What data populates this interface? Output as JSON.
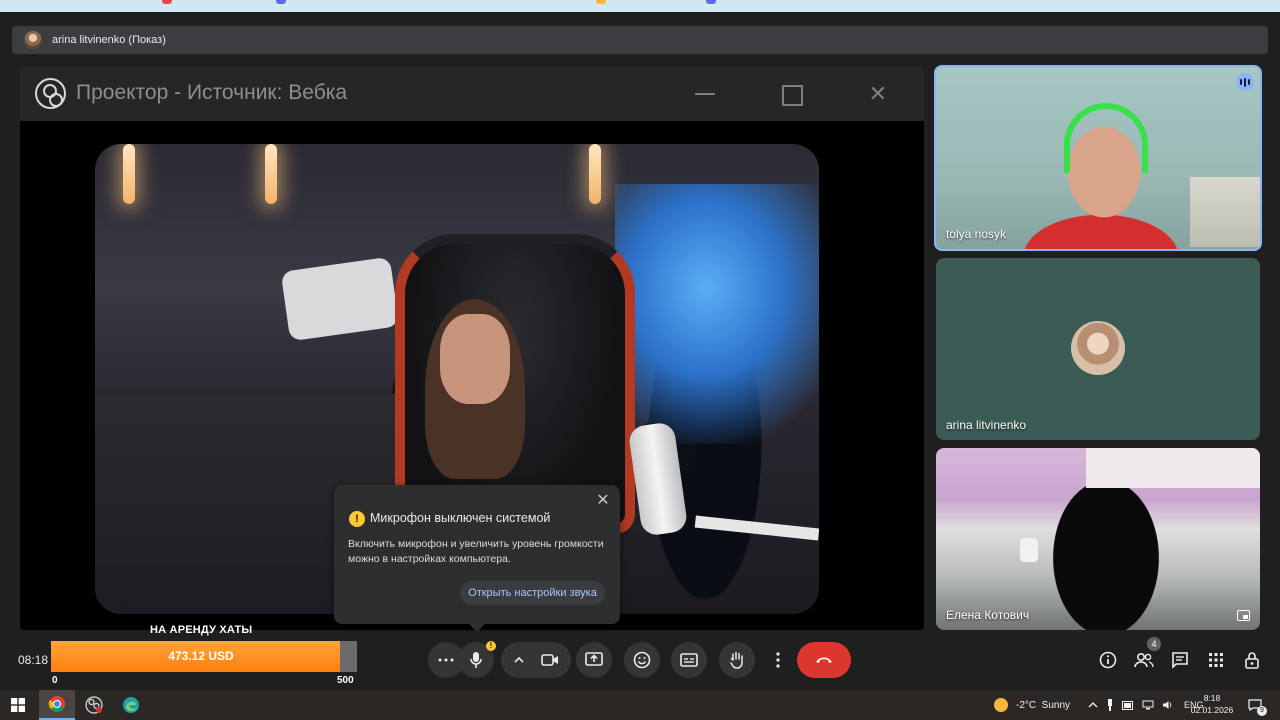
{
  "presenter": {
    "name": "arina litvinenko (Показ)"
  },
  "projector": {
    "title": "Проектор - Источник: Вебка"
  },
  "mic_dialog": {
    "title": "Микрофон выключен системой",
    "body": "Включить микрофон и увеличить уровень громкости можно в настройках компьютера.",
    "link": "Открыть настройки звука"
  },
  "participants": [
    {
      "name": "tolya nosyk",
      "speaking": true
    },
    {
      "name": "arina litvinenko",
      "speaking": false
    },
    {
      "name": "Елена Котович",
      "speaking": false
    }
  ],
  "clock": "08:18",
  "goal": {
    "title": "НА АРЕНДУ ХАТЫ",
    "amount": "473.12 USD",
    "progress_fraction": 0.946,
    "min_label": "0",
    "max_label": "500"
  },
  "people_count": "4",
  "colors": {
    "accent_blue": "#8ab4f8",
    "end_call_red": "#dc362e",
    "goal_orange": "#ff8c1a",
    "warning_yellow": "#fcc934"
  },
  "taskbar": {
    "weather": "-2°C  Sunny",
    "language": "ENG",
    "time": "8:18",
    "date": "02.01.2026",
    "notification_count": "9"
  }
}
